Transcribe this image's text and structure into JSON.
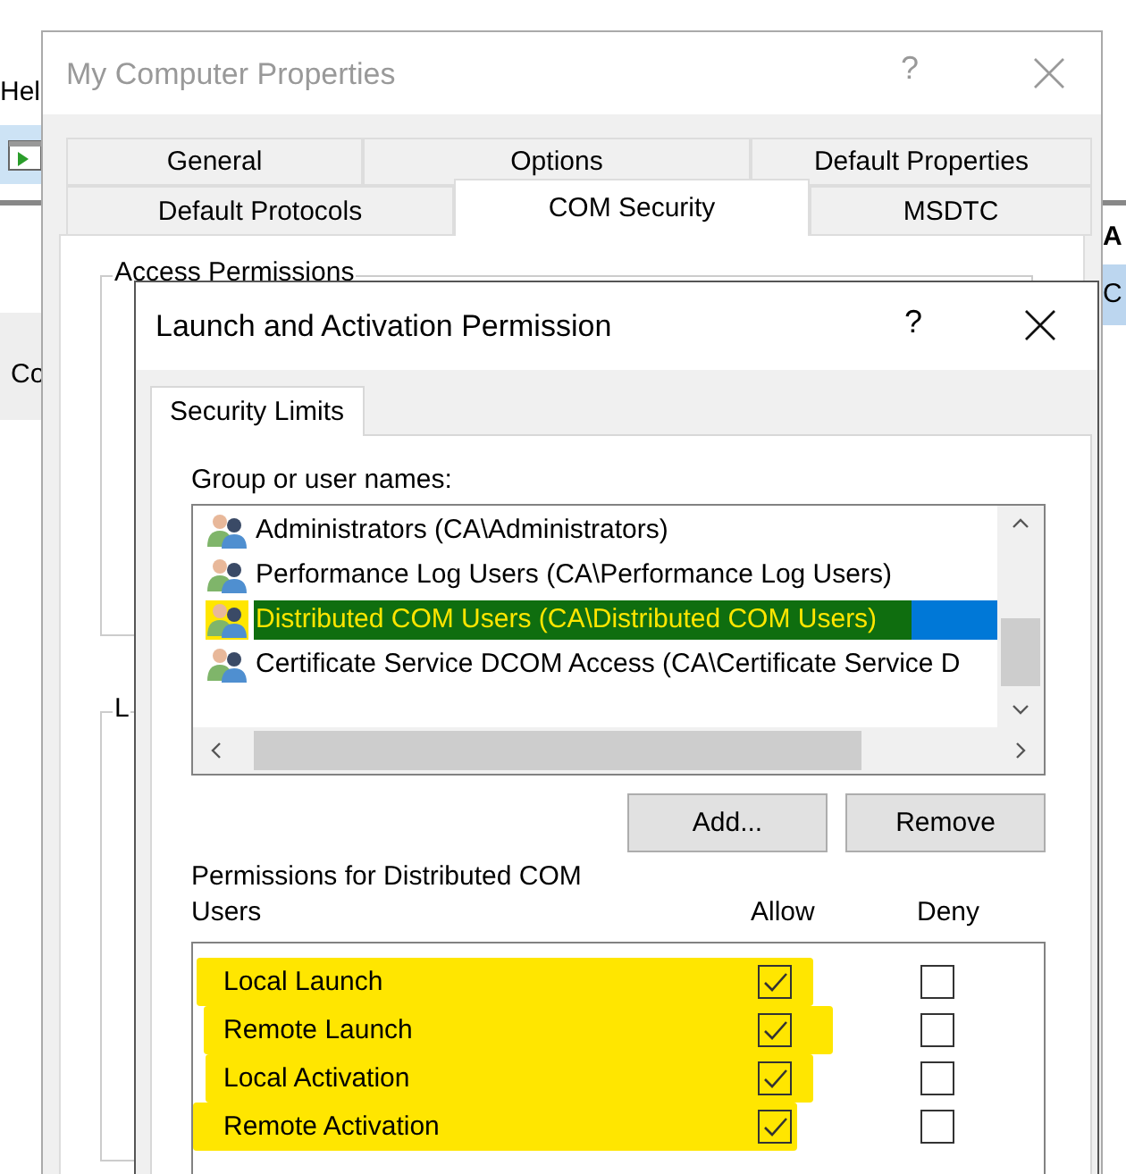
{
  "background_app": {
    "menu_text": "Hel",
    "left_text": "Co",
    "right_header": "A",
    "right_cell": "C"
  },
  "window": {
    "title": "My Computer Properties",
    "help": "?"
  },
  "tab_rows": [
    [
      {
        "label": "General",
        "selected": false
      },
      {
        "label": "Options",
        "selected": false
      },
      {
        "label": "Default Properties",
        "selected": false
      }
    ],
    [
      {
        "label": "Default Protocols",
        "selected": false
      },
      {
        "label": "COM Security",
        "selected": true
      },
      {
        "label": "MSDTC",
        "selected": false
      }
    ]
  ],
  "groups": [
    {
      "label": "Access Permissions"
    },
    {
      "label": "L"
    }
  ],
  "dialog": {
    "title": "Launch and Activation Permission",
    "help": "?",
    "tabs": [
      {
        "label": "Security Limits",
        "selected": true
      }
    ],
    "users_label": "Group or user names:",
    "users": [
      {
        "name": "Administrators (CA\\Administrators)",
        "selected": false,
        "highlighted": false
      },
      {
        "name": "Performance Log Users (CA\\Performance Log Users)",
        "selected": false,
        "highlighted": false
      },
      {
        "name": "Distributed COM Users (CA\\Distributed COM Users)",
        "selected": true,
        "highlighted": true
      },
      {
        "name": "Certificate Service DCOM Access (CA\\Certificate Service D",
        "selected": false,
        "highlighted": false
      }
    ],
    "buttons": [
      "Add...",
      "Remove"
    ],
    "permissions_label": "Permissions for Distributed COM Users",
    "columns": [
      "Allow",
      "Deny"
    ],
    "permissions": [
      {
        "name": "Local Launch",
        "allow": true,
        "deny": false,
        "highlighted": true
      },
      {
        "name": "Remote Launch",
        "allow": true,
        "deny": false,
        "highlighted": true
      },
      {
        "name": "Local Activation",
        "allow": true,
        "deny": false,
        "highlighted": true
      },
      {
        "name": "Remote Activation",
        "allow": true,
        "deny": false,
        "highlighted": true
      }
    ]
  }
}
